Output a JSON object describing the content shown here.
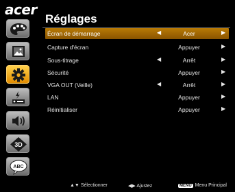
{
  "brand": "acer",
  "title": "Réglages",
  "sidebar": {
    "items": [
      {
        "icon": "palette-icon",
        "active": false
      },
      {
        "icon": "image-icon",
        "active": false
      },
      {
        "icon": "gear-icon",
        "active": true
      },
      {
        "icon": "power-management-icon",
        "active": false
      },
      {
        "icon": "speaker-icon",
        "active": false
      },
      {
        "icon": "3d-icon",
        "active": false,
        "text": "3D"
      },
      {
        "icon": "language-icon",
        "active": false,
        "text": "ABC"
      }
    ]
  },
  "settings": [
    {
      "label": "Écran de démarrage",
      "value": "Acer",
      "left_arrow": true,
      "selected": true
    },
    {
      "label": "Capture d'écran",
      "value": "Appuyer",
      "left_arrow": false,
      "selected": false
    },
    {
      "label": "Sous-titrage",
      "value": "Arrêt",
      "left_arrow": true,
      "selected": false
    },
    {
      "label": "Sécurité",
      "value": "Appuyer",
      "left_arrow": false,
      "selected": false
    },
    {
      "label": "VGA OUT (Veille)",
      "value": "Arrêt",
      "left_arrow": true,
      "selected": false
    },
    {
      "label": "LAN",
      "value": "Appuyer",
      "left_arrow": false,
      "selected": false
    },
    {
      "label": "Réinitialiser",
      "value": "Appuyer",
      "left_arrow": false,
      "selected": false
    }
  ],
  "footer": {
    "select_symbol": "▲▼",
    "select_label": "Sélectionner",
    "adjust_symbol": "◀▶",
    "adjust_label": "Ajustez",
    "menu_key": "MENU",
    "menu_label": "Menu Principal"
  },
  "colors": {
    "selected_row": "#a86a00",
    "active_tab": "#f2a81e",
    "background": "#000000"
  }
}
